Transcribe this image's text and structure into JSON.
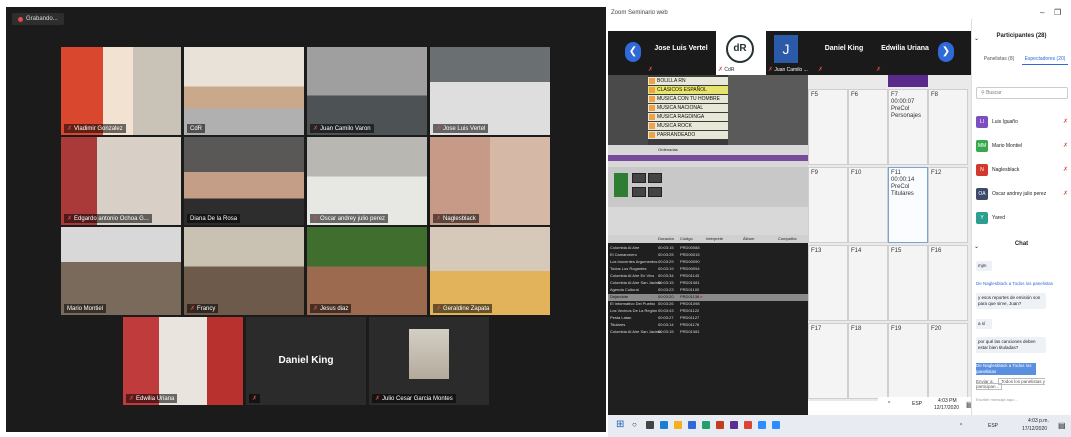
{
  "recording": {
    "label": "Grabando..."
  },
  "gallery": {
    "tiles": [
      {
        "name": "Vladimir Gonzalez"
      },
      {
        "name": "CdR"
      },
      {
        "name": "Juan Camilo Varon"
      },
      {
        "name": "Jose Luis Vertel"
      },
      {
        "name": "Edgardo antonio Ochoa G..."
      },
      {
        "name": "Diana De la Rosa"
      },
      {
        "name": "Oscar andrey julio perez"
      },
      {
        "name": "Naglesblack"
      },
      {
        "name": "Mario Montiel"
      },
      {
        "name": "Francy"
      },
      {
        "name": "Jesus diaz"
      },
      {
        "name": "Geraldine Zapata"
      },
      {
        "name": "Edwilia Uriana"
      },
      {
        "name": "Daniel King"
      },
      {
        "name": "Julio Cesar Garcia Montes"
      }
    ]
  },
  "window": {
    "title": "Zoom Seminario web",
    "minimize": "–",
    "restore": "❐",
    "close": "✕"
  },
  "speakerbar": {
    "prev": "❮",
    "next": "❯",
    "speakers": [
      {
        "name": "Jose Luis Vertel",
        "sub": ""
      },
      {
        "name": "",
        "sub": "CdR"
      },
      {
        "name": "",
        "sub": "Juan Camilo ..."
      },
      {
        "name": "Daniel King",
        "sub": ""
      },
      {
        "name": "Edwilia Uriana",
        "sub": ""
      }
    ],
    "cdr_logo": "dR",
    "j_initial": "J"
  },
  "app": {
    "tree": [
      "BOLILLA RN",
      "CLASICOS ESPAÑOL",
      "MUSICA CON TU HOMBRE",
      "MUSICA NACIONAL",
      "MUSICA RAGDINGA",
      "MUSICA ROCK",
      "PARRANDEADO"
    ],
    "tree_caption": "Ordenadas",
    "list_headers": [
      "Duración",
      "Código",
      "Intérprete",
      "Álbum",
      "Compañía"
    ],
    "rows": [
      [
        "Colombia Al Aire",
        "00:03:15",
        "PRD00088"
      ],
      [
        "El Camaronero",
        "00:03:25",
        "PRD00015"
      ],
      [
        "Los Inocentes Argumentos",
        "00:03:29",
        "PRD00090"
      ],
      [
        "Todos Los Rogantes",
        "00:03:19",
        "PRD00094"
      ],
      [
        "Colombia Al Aire En Vivo",
        "00:03:34",
        "PRD01143"
      ],
      [
        "Colombia Al Aire San Jacinto",
        "00:03:15",
        "PRD01081"
      ],
      [
        "Agenda Cultural",
        "00:03:23",
        "PRD01100"
      ],
      [
        "Dejándote",
        "00:03:20",
        "PRD01138"
      ],
      [
        "El Informativo Del Pueblo",
        "00:03:26",
        "PRD01098"
      ],
      [
        "Los Vecinos De La Región",
        "00:03:43",
        "PRD01122"
      ],
      [
        "Pesta Latan",
        "00:03:27",
        "PRD01127"
      ],
      [
        "Titulares",
        "00:03:14",
        "PRD01176"
      ],
      [
        "Colombia Al Aire San Jacinto",
        "00:03:15",
        "PRD01081"
      ]
    ]
  },
  "grid": {
    "cells": [
      {
        "label": "F5",
        "detail": ""
      },
      {
        "label": "F6",
        "detail": ""
      },
      {
        "label": "F7",
        "detail": "00:00:07 PreCol Personajes"
      },
      {
        "label": "F8",
        "detail": ""
      },
      {
        "label": "F9",
        "detail": ""
      },
      {
        "label": "F10",
        "detail": ""
      },
      {
        "label": "F11",
        "detail": "00:00:14 PreCol Titulares"
      },
      {
        "label": "F12",
        "detail": ""
      },
      {
        "label": "F13",
        "detail": ""
      },
      {
        "label": "F14",
        "detail": ""
      },
      {
        "label": "F15",
        "detail": ""
      },
      {
        "label": "F16",
        "detail": ""
      },
      {
        "label": "F17",
        "detail": ""
      },
      {
        "label": "F18",
        "detail": ""
      },
      {
        "label": "F19",
        "detail": ""
      },
      {
        "label": "F20",
        "detail": ""
      }
    ]
  },
  "inner_tray": {
    "time": "4:03 PM",
    "date": "12/17/2020",
    "lang": "ESP"
  },
  "participants": {
    "title": "Participantes (28)",
    "tab_panelists": "Panelistas (8)",
    "tab_attendees": "Espectadores (20)",
    "search_placeholder": "Buscar",
    "list": [
      {
        "initial": "LI",
        "name": "Luis Iguaño",
        "color": "#7b4fbf"
      },
      {
        "initial": "MM",
        "name": "Mario Montiel",
        "color": "#38a84e"
      },
      {
        "initial": "N",
        "name": "Naglesblack",
        "color": "#d0392b"
      },
      {
        "initial": "OA",
        "name": "Oscar andrey julio perez",
        "color": "#3c4a6b"
      },
      {
        "initial": "Y",
        "name": "Yared",
        "color": "#2b9e8f"
      }
    ]
  },
  "chat": {
    "title": "Chat",
    "messages": [
      {
        "meta": "",
        "text": "mjm",
        "bubble": true
      },
      {
        "meta": "De Naglesblack a Todos los panelistas",
        "text": "",
        "bubble": false
      },
      {
        "meta": "",
        "text": "y esos reportes de emisión son para que sirve, Juan?",
        "bubble": true
      },
      {
        "meta": "",
        "text": "a sí",
        "bubble": true
      },
      {
        "meta": "",
        "text": "por qué las canciones deben estar bien tituladas?",
        "bubble": true
      },
      {
        "meta": "De Naglesblack a Todos los panelistas",
        "text": "",
        "bubble": false
      }
    ],
    "send_label": "Enviar a:",
    "send_target": "Todos los panelistas y participan...",
    "input_placeholder": "Escribir mensaje aquí..."
  },
  "outer_tray": {
    "time": "4:03 p.m.",
    "date": "17/12/2020",
    "lang": "ESP"
  }
}
